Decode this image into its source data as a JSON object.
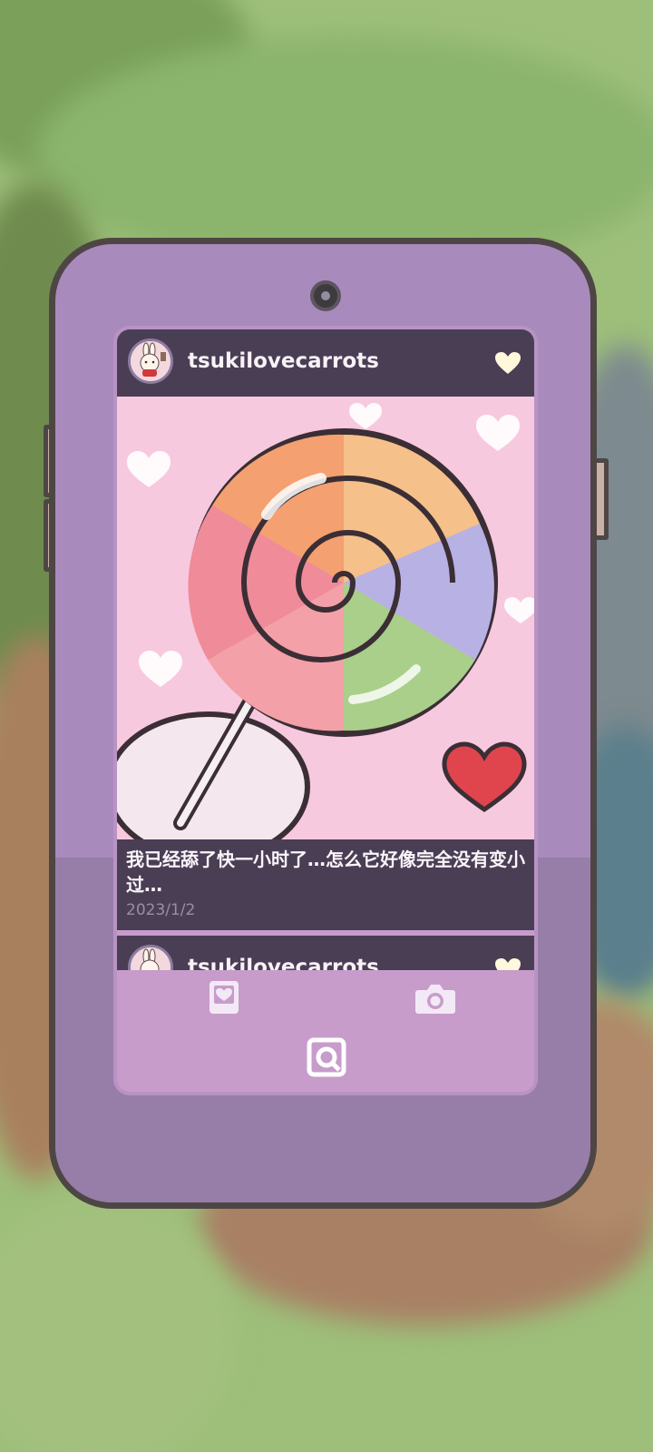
{
  "posts": [
    {
      "username": "tsukilovecarrots",
      "caption": "我已经舔了快一小时了…怎么它好像完全没有变小过…",
      "date": "2023/1/2",
      "liked": true
    },
    {
      "username": "tsukilovecarrots",
      "liked": true
    }
  ],
  "tabs": [
    "liked-posts-icon",
    "camera-icon",
    "photo-app-icon"
  ],
  "colors": {
    "phone_body": "#a98abd",
    "post_background": "#4a3e55",
    "screen_background": "#c79ccb",
    "heart": "#fff8dc",
    "accent_heart": "#e0454e"
  }
}
